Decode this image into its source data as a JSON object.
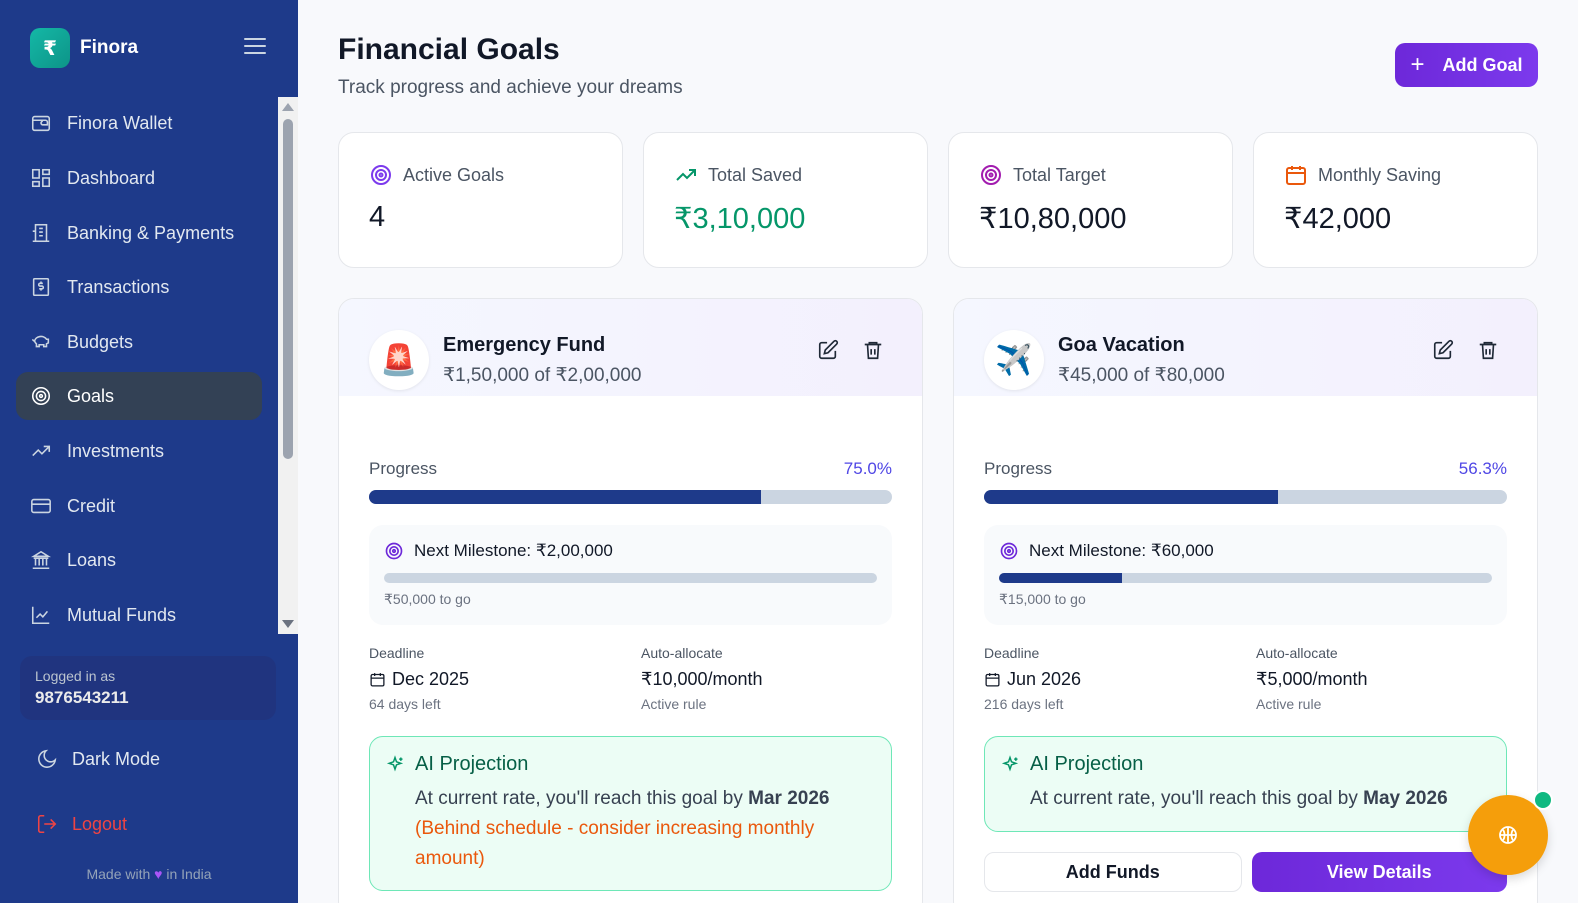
{
  "brand": {
    "logo": "₹",
    "name": "Finora"
  },
  "sidebar": {
    "items": [
      {
        "label": "Finora Wallet",
        "icon": "wallet-icon"
      },
      {
        "label": "Dashboard",
        "icon": "dashboard-icon"
      },
      {
        "label": "Banking & Payments",
        "icon": "bank-building-icon"
      },
      {
        "label": "Transactions",
        "icon": "receipt-icon"
      },
      {
        "label": "Budgets",
        "icon": "piggy-bank-icon"
      },
      {
        "label": "Goals",
        "icon": "target-icon",
        "active": true
      },
      {
        "label": "Investments",
        "icon": "trend-up-icon"
      },
      {
        "label": "Credit",
        "icon": "credit-card-icon"
      },
      {
        "label": "Loans",
        "icon": "landmark-icon"
      },
      {
        "label": "Mutual Funds",
        "icon": "line-chart-icon"
      }
    ],
    "logged_in_label": "Logged in as",
    "logged_in_phone": "9876543211",
    "dark_mode_label": "Dark Mode",
    "logout_label": "Logout",
    "made_with_prefix": "Made with",
    "made_with_suffix": "in India"
  },
  "header": {
    "title": "Financial Goals",
    "subtitle": "Track progress and achieve your dreams",
    "add_goal_label": "Add Goal"
  },
  "stats": [
    {
      "label": "Active Goals",
      "value": "4",
      "icon": "target-icon",
      "color": "#7c3aed"
    },
    {
      "label": "Total Saved",
      "value": "₹3,10,000",
      "icon": "trend-up-icon",
      "color": "#059669"
    },
    {
      "label": "Total Target",
      "value": "₹10,80,000",
      "icon": "target-icon",
      "color": "#a21caf"
    },
    {
      "label": "Monthly Saving",
      "value": "₹42,000",
      "icon": "calendar-icon",
      "color": "#ea580c"
    }
  ],
  "goals": [
    {
      "emoji": "🚨",
      "name": "Emergency Fund",
      "amount": "₹1,50,000 of ₹2,00,000",
      "progress_label": "Progress",
      "progress_pct_text": "75.0%",
      "progress": 0.75,
      "milestone_label": "Next Milestone: ₹2,00,000",
      "milestone_progress": 0,
      "milestone_togo": "₹50,000 to go",
      "deadline_label": "Deadline",
      "deadline": "Dec 2025",
      "days_left": "64 days left",
      "auto_label": "Auto-allocate",
      "auto_value": "₹10,000/month",
      "auto_status": "Active rule",
      "ai_title": "AI Projection",
      "ai_text": "At current rate, you'll reach this goal by",
      "ai_date": "Mar 2026",
      "ai_warning": "(Behind schedule - consider increasing monthly amount)"
    },
    {
      "emoji": "✈️",
      "name": "Goa Vacation",
      "amount": "₹45,000 of ₹80,000",
      "progress_label": "Progress",
      "progress_pct_text": "56.3%",
      "progress": 0.563,
      "milestone_label": "Next Milestone: ₹60,000",
      "milestone_progress": 0.25,
      "milestone_togo": "₹15,000 to go",
      "deadline_label": "Deadline",
      "deadline": "Jun 2026",
      "days_left": "216 days left",
      "auto_label": "Auto-allocate",
      "auto_value": "₹5,000/month",
      "auto_status": "Active rule",
      "ai_title": "AI Projection",
      "ai_text": "At current rate, you'll reach this goal by",
      "ai_date": "May 2026",
      "add_funds_label": "Add Funds",
      "view_details_label": "View Details"
    }
  ]
}
